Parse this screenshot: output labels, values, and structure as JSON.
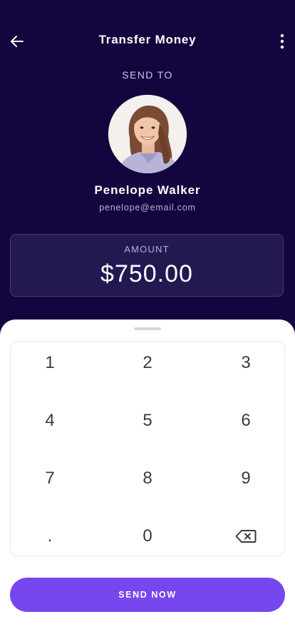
{
  "header": {
    "title": "Transfer Money",
    "back_icon": "arrow-left-icon",
    "more_icon": "more-vertical-icon"
  },
  "recipient": {
    "section_label": "SEND TO",
    "name": "Penelope Walker",
    "email": "penelope@email.com"
  },
  "amount": {
    "label": "AMOUNT",
    "value": "$750.00"
  },
  "keypad": {
    "keys": [
      "1",
      "2",
      "3",
      "4",
      "5",
      "6",
      "7",
      "8",
      "9",
      ".",
      "0"
    ],
    "backspace_icon": "backspace-icon"
  },
  "actions": {
    "send_label": "SEND NOW"
  },
  "colors": {
    "background": "#15053f",
    "accent": "#7646ee",
    "card": "#231850",
    "sheet": "#ffffff"
  }
}
